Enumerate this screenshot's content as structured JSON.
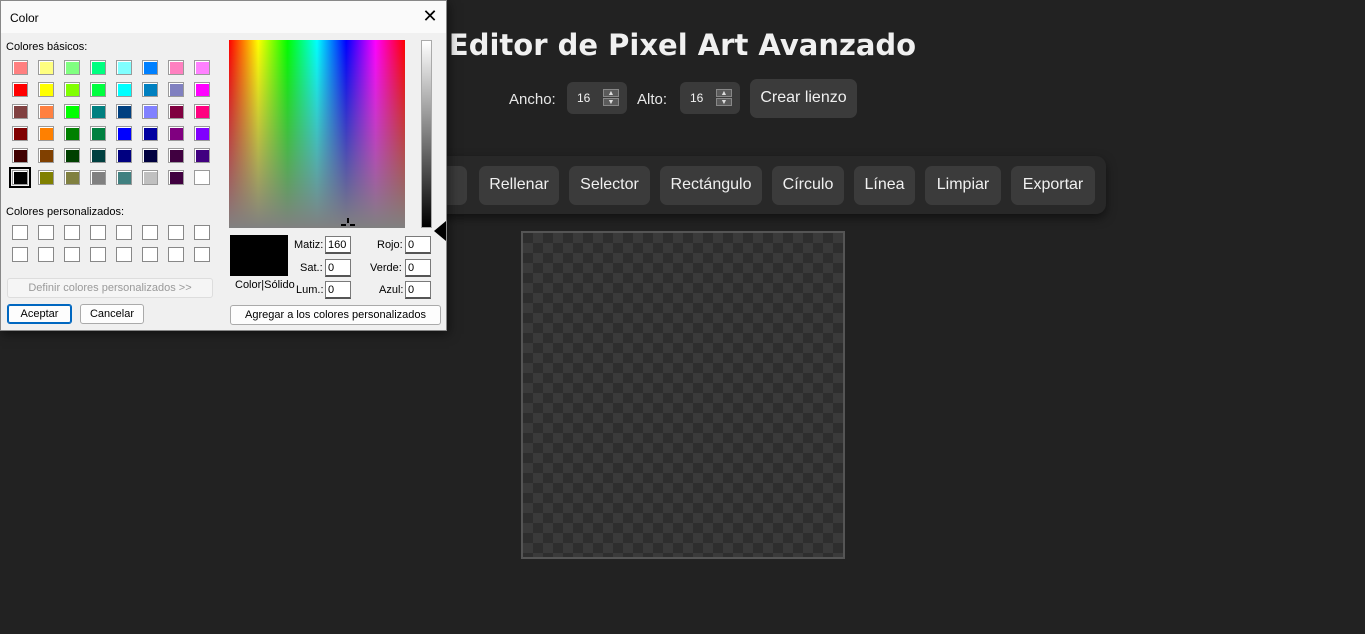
{
  "app": {
    "title": "Editor de Pixel Art Avanzado",
    "width_label": "Ancho:",
    "width_value": "16",
    "height_label": "Alto:",
    "height_value": "16",
    "create_button": "Crear lienzo"
  },
  "toolbar": {
    "tools": [
      "or",
      "Rellenar",
      "Selector",
      "Rectángulo",
      "Círculo",
      "Línea",
      "Limpiar",
      "Exportar"
    ]
  },
  "dialog": {
    "title": "Color",
    "close_glyph": "✕",
    "basic_colors_label": "Colores básicos:",
    "custom_colors_label": "Colores personalizados:",
    "define_custom_button": "Definir colores personalizados >>",
    "ok_button": "Aceptar",
    "cancel_button": "Cancelar",
    "add_custom_button": "Agregar a los colores personalizados",
    "preview_label": "Color|Sólido",
    "hue_label": "Matiz:",
    "hue_value": "160",
    "sat_label": "Sat.:",
    "sat_value": "0",
    "lum_label": "Lum.:",
    "lum_value": "0",
    "red_label": "Rojo:",
    "red_value": "0",
    "green_label": "Verde:",
    "green_value": "0",
    "blue_label": "Azul:",
    "blue_value": "0",
    "selected_color": "#000000",
    "basic_colors": [
      [
        "#ff8080",
        "#ffff80",
        "#80ff80",
        "#00ff80",
        "#80ffff",
        "#0080ff",
        "#ff80c0",
        "#ff80ff"
      ],
      [
        "#ff0000",
        "#ffff00",
        "#80ff00",
        "#00ff40",
        "#00ffff",
        "#0080c0",
        "#8080c0",
        "#ff00ff"
      ],
      [
        "#804040",
        "#ff8040",
        "#00ff00",
        "#008080",
        "#004080",
        "#8080ff",
        "#800040",
        "#ff0080"
      ],
      [
        "#800000",
        "#ff8000",
        "#008000",
        "#008040",
        "#0000ff",
        "#0000a0",
        "#800080",
        "#8000ff"
      ],
      [
        "#400000",
        "#804000",
        "#004000",
        "#004040",
        "#000080",
        "#000040",
        "#400040",
        "#400080"
      ],
      [
        "#000000",
        "#808000",
        "#808040",
        "#808080",
        "#408080",
        "#c0c0c0",
        "#400040",
        "#ffffff"
      ]
    ]
  }
}
